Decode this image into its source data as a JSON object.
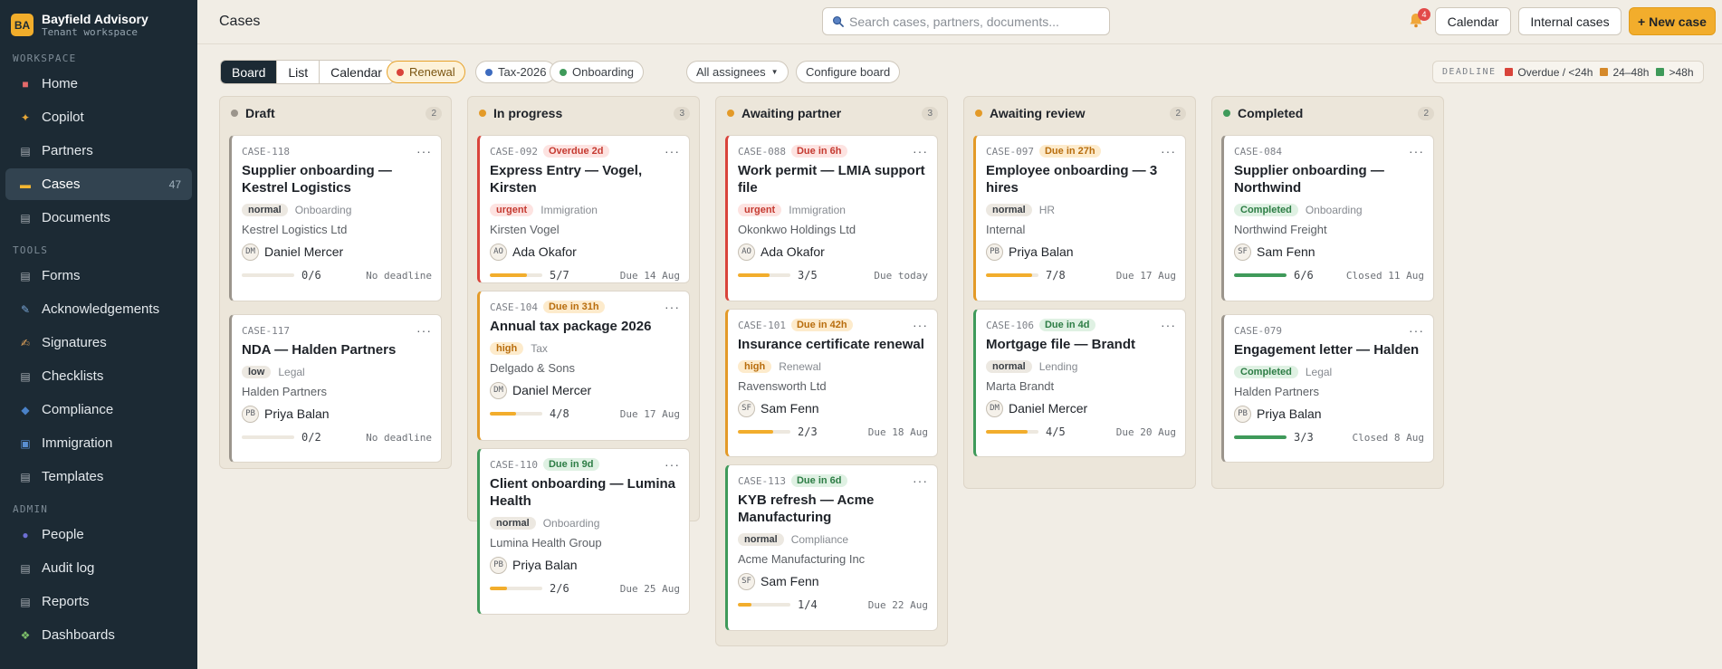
{
  "brand": {
    "initials": "BA",
    "name": "Bayfield Advisory",
    "subtitle": "Tenant workspace"
  },
  "sidebar": {
    "sections": [
      {
        "label": "WORKSPACE",
        "items": [
          {
            "label": "Home",
            "icon": "home-icon",
            "color": "#e46a6a"
          },
          {
            "label": "Copilot",
            "icon": "sparkle-icon",
            "color": "#e8a838"
          },
          {
            "label": "Partners",
            "icon": "partners-icon",
            "color": "#a3a9b0"
          },
          {
            "label": "Cases",
            "icon": "folder-icon",
            "color": "#f2b632",
            "count": "47",
            "active": true
          },
          {
            "label": "Documents",
            "icon": "document-icon",
            "color": "#a3a9b0"
          }
        ]
      },
      {
        "label": "TOOLS",
        "items": [
          {
            "label": "Forms",
            "icon": "form-icon",
            "color": "#a3a9b0"
          },
          {
            "label": "Acknowledgements",
            "icon": "pen-icon",
            "color": "#7aa7d8"
          },
          {
            "label": "Signatures",
            "icon": "signature-icon",
            "color": "#e0a25a"
          },
          {
            "label": "Checklists",
            "icon": "checklist-icon",
            "color": "#a3a9b0"
          },
          {
            "label": "Compliance",
            "icon": "shield-icon",
            "color": "#4a82c8"
          },
          {
            "label": "Immigration",
            "icon": "passport-icon",
            "color": "#5a8fd1"
          },
          {
            "label": "Templates",
            "icon": "template-icon",
            "color": "#a3a9b0"
          }
        ]
      },
      {
        "label": "ADMIN",
        "items": [
          {
            "label": "People",
            "icon": "people-icon",
            "color": "#6d6fd3"
          },
          {
            "label": "Audit log",
            "icon": "audit-icon",
            "color": "#a3a9b0"
          },
          {
            "label": "Reports",
            "icon": "reports-icon",
            "color": "#a3a9b0"
          },
          {
            "label": "Dashboards",
            "icon": "dashboard-icon",
            "color": "#7dbf6a"
          }
        ]
      }
    ]
  },
  "header": {
    "title": "Cases",
    "search_placeholder": "Search cases, partners, documents...",
    "notification_count": "4",
    "buttons": {
      "calendar": "Calendar",
      "internal": "Internal cases",
      "new_case": "+ New case"
    }
  },
  "toolbar": {
    "views": [
      "Board",
      "List",
      "Calendar"
    ],
    "active_view": "Board",
    "chips": [
      {
        "label": "Renewal",
        "color": "#d9443b",
        "active": true
      },
      {
        "label": "Tax-2026",
        "color": "#3d6bbf",
        "active": false
      },
      {
        "label": "Onboarding",
        "color": "#3f9a5a",
        "active": false
      }
    ],
    "assignee_filter": "All assignees",
    "configure": "Configure board",
    "legend": {
      "title": "DEADLINE",
      "items": [
        {
          "label": "Overdue / <24h",
          "color": "#d9443b"
        },
        {
          "label": "24–48h",
          "color": "#d5892a"
        },
        {
          "label": ">48h",
          "color": "#3f9a5a"
        }
      ]
    }
  },
  "colors": {
    "accent": "#f2ad2c",
    "red": "#d9443b",
    "orange": "#e39a28",
    "green": "#3f9a5a",
    "grey": "#9b958c"
  },
  "board": {
    "columns": [
      {
        "name": "Draft",
        "count": "2",
        "dot": "#9b958c",
        "cards": [
          {
            "id": "CASE-118",
            "due": "",
            "due_tone": "",
            "title": "Supplier onboarding — Kestrel Logistics",
            "priority": "normal",
            "category": "Onboarding",
            "client": "Kestrel Logistics Ltd",
            "assignee_initials": "DM",
            "assignee": "Daniel Mercer",
            "progress": "0/6",
            "progress_pct": 0,
            "deadline": "No deadline",
            "accent": "grey"
          },
          {
            "id": "CASE-117",
            "due": "",
            "due_tone": "",
            "title": "NDA — Halden Partners",
            "priority": "low",
            "category": "Legal",
            "client": "Halden Partners",
            "assignee_initials": "PB",
            "assignee": "Priya Balan",
            "progress": "0/2",
            "progress_pct": 0,
            "deadline": "No deadline",
            "accent": "grey"
          }
        ]
      },
      {
        "name": "In progress",
        "count": "3",
        "dot": "#e39a28",
        "cards": [
          {
            "id": "CASE-092",
            "due": "Overdue 2d",
            "due_tone": "red",
            "title": "Express Entry — Vogel, Kirsten",
            "priority": "urgent",
            "category": "Immigration",
            "client": "Kirsten Vogel",
            "assignee_initials": "AO",
            "assignee": "Ada Okafor",
            "progress": "5/7",
            "progress_pct": 71,
            "deadline": "Due 14 Aug",
            "accent": "red"
          },
          {
            "id": "CASE-104",
            "due": "Due in 31h",
            "due_tone": "orange",
            "title": "Annual tax package 2026",
            "priority": "high",
            "category": "Tax",
            "client": "Delgado & Sons",
            "assignee_initials": "DM",
            "assignee": "Daniel Mercer",
            "progress": "4/8",
            "progress_pct": 50,
            "deadline": "Due 17 Aug",
            "accent": "orange"
          },
          {
            "id": "CASE-110",
            "due": "Due in 9d",
            "due_tone": "green",
            "title": "Client onboarding — Lumina Health",
            "priority": "normal",
            "category": "Onboarding",
            "client": "Lumina Health Group",
            "assignee_initials": "PB",
            "assignee": "Priya Balan",
            "progress": "2/6",
            "progress_pct": 33,
            "deadline": "Due 25 Aug",
            "accent": "green"
          }
        ]
      },
      {
        "name": "Awaiting partner",
        "count": "3",
        "dot": "#e39a28",
        "cards": [
          {
            "id": "CASE-088",
            "due": "Due in 6h",
            "due_tone": "red",
            "title": "Work permit — LMIA support file",
            "priority": "urgent",
            "category": "Immigration",
            "client": "Okonkwo Holdings Ltd",
            "assignee_initials": "AO",
            "assignee": "Ada Okafor",
            "progress": "3/5",
            "progress_pct": 60,
            "deadline": "Due today",
            "accent": "red"
          },
          {
            "id": "CASE-101",
            "due": "Due in 42h",
            "due_tone": "orange",
            "title": "Insurance certificate renewal",
            "priority": "high",
            "category": "Renewal",
            "client": "Ravensworth Ltd",
            "assignee_initials": "SF",
            "assignee": "Sam Fenn",
            "progress": "2/3",
            "progress_pct": 67,
            "deadline": "Due 18 Aug",
            "accent": "orange"
          },
          {
            "id": "CASE-113",
            "due": "Due in 6d",
            "due_tone": "green",
            "title": "KYB refresh — Acme Manufacturing",
            "priority": "normal",
            "category": "Compliance",
            "client": "Acme Manufacturing Inc",
            "assignee_initials": "SF",
            "assignee": "Sam Fenn",
            "progress": "1/4",
            "progress_pct": 25,
            "deadline": "Due 22 Aug",
            "accent": "green"
          }
        ]
      },
      {
        "name": "Awaiting review",
        "count": "2",
        "dot": "#e39a28",
        "cards": [
          {
            "id": "CASE-097",
            "due": "Due in 27h",
            "due_tone": "orange",
            "title": "Employee onboarding — 3 hires",
            "priority": "normal",
            "category": "HR",
            "client": "Internal",
            "assignee_initials": "PB",
            "assignee": "Priya Balan",
            "progress": "7/8",
            "progress_pct": 88,
            "deadline": "Due 17 Aug",
            "accent": "orange"
          },
          {
            "id": "CASE-106",
            "due": "Due in 4d",
            "due_tone": "green",
            "title": "Mortgage file — Brandt",
            "priority": "normal",
            "category": "Lending",
            "client": "Marta Brandt",
            "assignee_initials": "DM",
            "assignee": "Daniel Mercer",
            "progress": "4/5",
            "progress_pct": 80,
            "deadline": "Due 20 Aug",
            "accent": "green"
          }
        ]
      },
      {
        "name": "Completed",
        "count": "2",
        "dot": "#3f9a5a",
        "cards": [
          {
            "id": "CASE-084",
            "due": "",
            "due_tone": "",
            "title": "Supplier onboarding — Northwind",
            "priority": "Completed",
            "category": "Onboarding",
            "client": "Northwind Freight",
            "assignee_initials": "SF",
            "assignee": "Sam Fenn",
            "progress": "6/6",
            "progress_pct": 100,
            "deadline": "Closed 11 Aug",
            "accent": "grey"
          },
          {
            "id": "CASE-079",
            "due": "",
            "due_tone": "",
            "title": "Engagement letter — Halden",
            "priority": "Completed",
            "category": "Legal",
            "client": "Halden Partners",
            "assignee_initials": "PB",
            "assignee": "Priya Balan",
            "progress": "3/3",
            "progress_pct": 100,
            "deadline": "Closed 8 Aug",
            "accent": "grey"
          }
        ]
      }
    ]
  }
}
